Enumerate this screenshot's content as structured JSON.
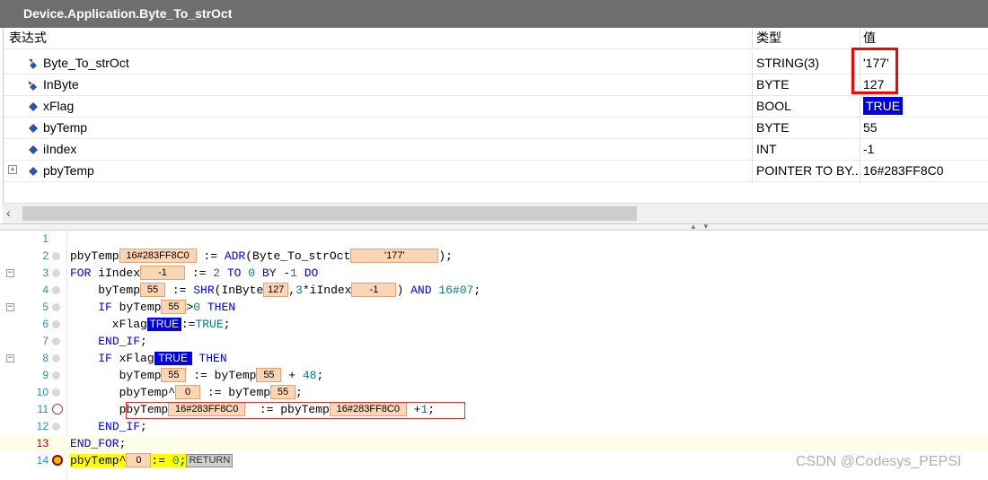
{
  "window": {
    "title": "Device.Application.Byte_To_strOct"
  },
  "watch": {
    "columns": {
      "expression": "表达式",
      "type": "类型",
      "value": "值"
    },
    "rows": [
      {
        "name": "Byte_To_strOct",
        "type": "STRING(3)",
        "value": "'177'",
        "icon": "output-var-icon"
      },
      {
        "name": "InByte",
        "type": "BYTE",
        "value": "127",
        "icon": "input-var-icon"
      },
      {
        "name": "xFlag",
        "type": "BOOL",
        "value": "TRUE",
        "icon": "local-var-icon"
      },
      {
        "name": "byTemp",
        "type": "BYTE",
        "value": "55",
        "icon": "local-var-icon"
      },
      {
        "name": "iIndex",
        "type": "INT",
        "value": "-1",
        "icon": "local-var-icon"
      },
      {
        "name": "pbyTemp",
        "type": "POINTER TO BY...",
        "value": "16#283FF8C0",
        "icon": "local-var-icon"
      }
    ]
  },
  "editor": {
    "line_numbers": [
      "1",
      "2",
      "3",
      "4",
      "5",
      "6",
      "7",
      "8",
      "9",
      "10",
      "11",
      "12",
      "13",
      "14"
    ],
    "mon": {
      "l2_pby": "16#283FF8C0",
      "l2_str": "'177'",
      "l3_idx": "-1",
      "l4_by": "55",
      "l4_in": "127",
      "l4_idx": "-1",
      "l5_by": "55",
      "l6_x": "TRUE",
      "l8_x": "TRUE",
      "l9_by1": "55",
      "l9_by2": "55",
      "l10_p": "0",
      "l10_by": "55",
      "l11_p1": "16#283FF8C0",
      "l11_p2": "16#283FF8C0",
      "l14_p": "0",
      "l14_ret": "RETURN"
    }
  },
  "watermark": "CSDN @Codesys_PEPSI",
  "colors": {
    "title_bar": "#6e6e6e",
    "true_bg": "#0000e0",
    "monitor_bg": "#fcd5b4",
    "highlight_red": "#ff0000",
    "exec_line": "#ffff00"
  }
}
